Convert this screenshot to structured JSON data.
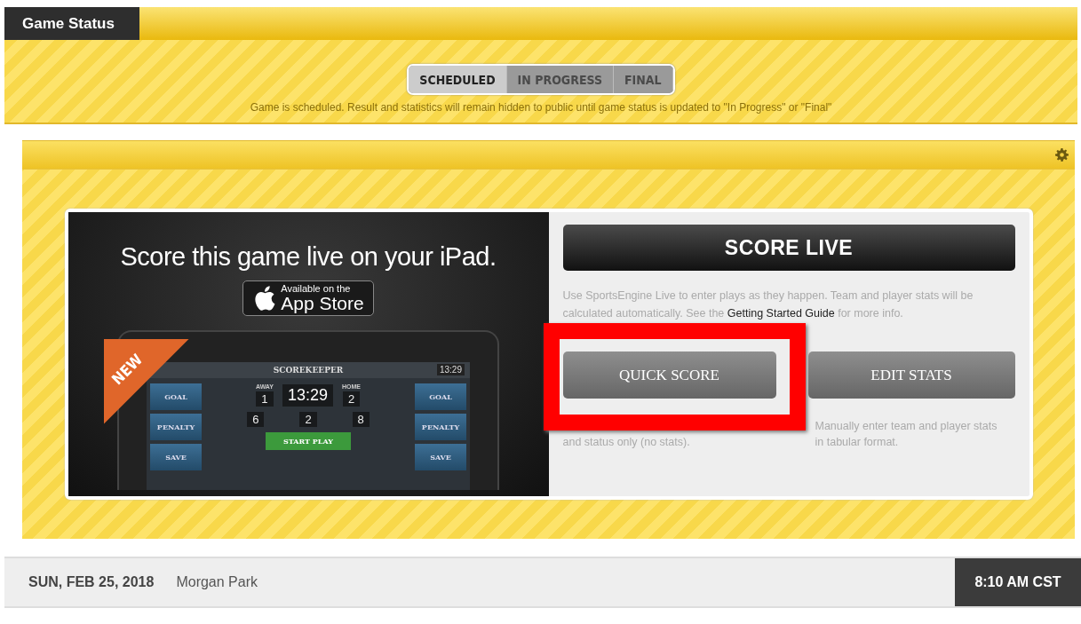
{
  "header": {
    "title": "Game Status"
  },
  "status_tabs": [
    {
      "label": "SCHEDULED",
      "selected": true
    },
    {
      "label": "IN PROGRESS",
      "selected": false
    },
    {
      "label": "FINAL",
      "selected": false
    }
  ],
  "status_note": "Game is scheduled. Result and statistics will remain hidden to public until game status is updated to \"In Progress\" or \"Final\"",
  "promo": {
    "headline": "Score this game live on your iPad.",
    "badge_small": "Available on the",
    "badge_large": "App Store",
    "ribbon": "NEW",
    "ipad": {
      "title": "SCOREKEEPER",
      "top_clock": "13:29",
      "away_label": "AWAY",
      "away_score": "1",
      "home_label": "HOME",
      "home_score": "2",
      "clock": "13:29",
      "left_buttons": [
        "GOAL",
        "PENALTY",
        "SAVE"
      ],
      "right_buttons": [
        "GOAL",
        "PENALTY",
        "SAVE"
      ],
      "counts": [
        "6",
        "2",
        "8"
      ],
      "start": "START PLAY"
    }
  },
  "score_live": {
    "button": "SCORE LIVE",
    "text_before": "Use SportsEngine Live to enter plays as they happen. Team and player stats will be calculated automatically. See the ",
    "link": "Getting Started Guide",
    "text_after": " for more info."
  },
  "options": [
    {
      "button": "QUICK SCORE",
      "description": "and status only (no stats).",
      "highlighted": true
    },
    {
      "button": "EDIT STATS",
      "description": "Manually enter team and player stats in tabular format.",
      "highlighted": false
    }
  ],
  "footer": {
    "date": "SUN, FEB 25, 2018",
    "location": "Morgan Park",
    "time": "8:10 AM CST"
  }
}
